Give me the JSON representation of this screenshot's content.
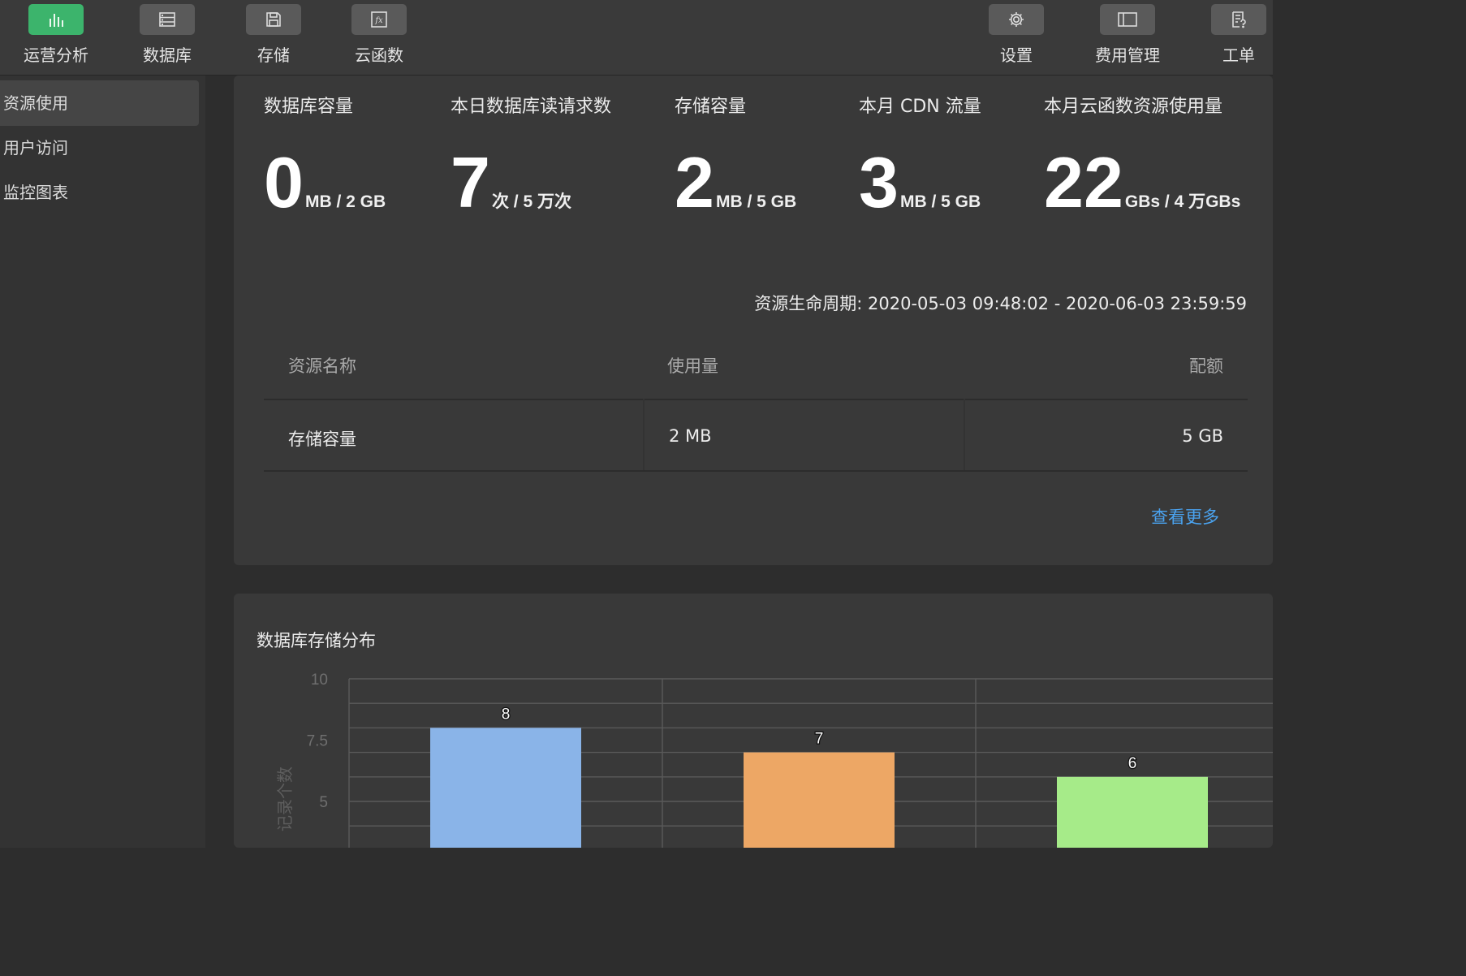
{
  "toolbar": {
    "left_tools": [
      {
        "label": "运营分析",
        "icon": "bar-chart-icon",
        "active": true
      },
      {
        "label": "数据库",
        "icon": "database-icon",
        "active": false
      },
      {
        "label": "存储",
        "icon": "save-icon",
        "active": false
      },
      {
        "label": "云函数",
        "icon": "function-icon",
        "active": false
      }
    ],
    "right_tools": [
      {
        "label": "设置",
        "icon": "gear-icon"
      },
      {
        "label": "费用管理",
        "icon": "billing-icon"
      },
      {
        "label": "工单",
        "icon": "ticket-icon"
      }
    ]
  },
  "sidebar": {
    "items": [
      {
        "label": "资源使用",
        "active": true
      },
      {
        "label": "用户访问",
        "active": false
      },
      {
        "label": "监控图表",
        "active": false
      }
    ]
  },
  "stats": [
    {
      "title": "数据库容量",
      "value": "0",
      "unit": "MB / 2 GB"
    },
    {
      "title": "本日数据库读请求数",
      "value": "7",
      "unit": "次 / 5 万次"
    },
    {
      "title": "存储容量",
      "value": "2",
      "unit": "MB / 5 GB"
    },
    {
      "title": "本月 CDN 流量",
      "value": "3",
      "unit": "MB / 5 GB"
    },
    {
      "title": "本月云函数资源使用量",
      "value": "22",
      "unit": "GBs / 4 万GBs"
    }
  ],
  "lifecycle": {
    "label": "资源生命周期:",
    "range": "2020-05-03 09:48:02 - 2020-06-03 23:59:59"
  },
  "resource_table": {
    "headers": [
      "资源名称",
      "使用量",
      "配额"
    ],
    "rows": [
      [
        "存储容量",
        "2 MB",
        "5 GB"
      ]
    ],
    "more_link": "查看更多"
  },
  "chart_section": {
    "title": "数据库存储分布"
  },
  "chart_data": {
    "type": "bar",
    "title": "数据库存储分布",
    "ylabel": "记录个数",
    "ylim": [
      0,
      10
    ],
    "yticks_visible": [
      "10",
      "7.5",
      "5"
    ],
    "values": [
      8,
      7,
      6
    ],
    "colors": [
      "#8ab4e8",
      "#eda765",
      "#a6eb89"
    ],
    "grid": true
  },
  "colors": {
    "accent_green": "#3cb46c",
    "link_blue": "#4aa3f0"
  }
}
